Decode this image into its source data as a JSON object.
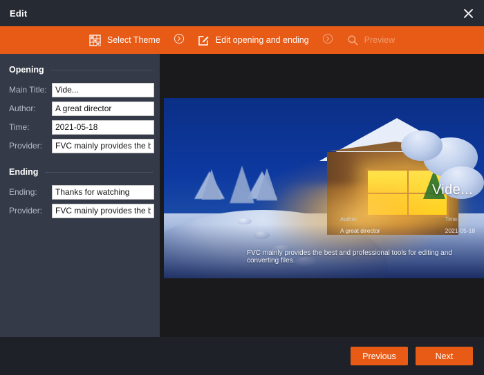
{
  "window": {
    "title": "Edit",
    "close_icon": "close-icon"
  },
  "steps": {
    "items": [
      {
        "label": "Select Theme",
        "icon": "theme-grid-icon",
        "enabled": true
      },
      {
        "label": "Edit opening and ending",
        "icon": "edit-square-icon",
        "enabled": true
      },
      {
        "label": "Preview",
        "icon": "search-icon",
        "enabled": false
      }
    ],
    "separator_icon": "chevron-right-circle-icon"
  },
  "sidebar": {
    "opening": {
      "title": "Opening",
      "fields": [
        {
          "label": "Main Title:",
          "value": "Vide...",
          "name": "main-title"
        },
        {
          "label": "Author:",
          "value": "A great director",
          "name": "author"
        },
        {
          "label": "Time:",
          "value": "2021-05-18",
          "name": "time"
        },
        {
          "label": "Provider:",
          "value": "FVC mainly provides the best and professional tools for editing and converting files.",
          "name": "provider-opening"
        }
      ]
    },
    "ending": {
      "title": "Ending",
      "fields": [
        {
          "label": "Ending:",
          "value": "Thanks for watching",
          "name": "ending"
        },
        {
          "label": "Provider:",
          "value": "FVC mainly provides the best and professional tools for editing and converting files.",
          "name": "provider-ending"
        }
      ]
    }
  },
  "preview": {
    "overlay_title": "Vide...",
    "author_label": "Author:",
    "author_value": "A great director",
    "time_label": "Time:",
    "time_value": "2021-05-18",
    "provider_text": "FVC mainly provides the best and professional tools for editing and converting files.",
    "scene": "winter-cabin-night"
  },
  "footer": {
    "previous_label": "Previous",
    "next_label": "Next"
  },
  "colors": {
    "accent": "#e85b17",
    "titlebar": "#262a33",
    "sidebar": "#343a47",
    "stage": "#1a1a1c",
    "footer": "#1f2128",
    "label_text": "#b4bac6",
    "disabled_step": "#f09a6e"
  }
}
